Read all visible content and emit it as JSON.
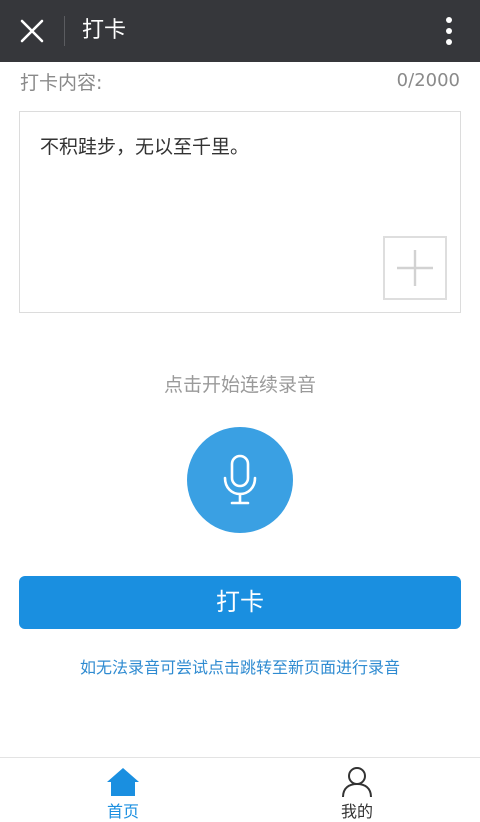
{
  "header": {
    "title": "打卡",
    "close_icon": "close-icon",
    "more_icon": "more-vertical-icon",
    "background": "#36373b"
  },
  "form": {
    "content_label": "打卡内容:",
    "char_counter": "0/2000",
    "text": "不积跬步，无以至千里。",
    "add_media_icon": "plus-icon"
  },
  "recording": {
    "hint": "点击开始连续录音",
    "mic_icon": "microphone-icon",
    "mic_color": "#3aa0e3"
  },
  "actions": {
    "checkin_label": "打卡",
    "checkin_color": "#1a8fe0",
    "fallback_link": "如无法录音可尝试点击跳转至新页面进行录音"
  },
  "tabbar": {
    "items": [
      {
        "label": "首页",
        "icon": "home-icon",
        "active": true
      },
      {
        "label": "我的",
        "icon": "user-icon",
        "active": false
      }
    ]
  }
}
